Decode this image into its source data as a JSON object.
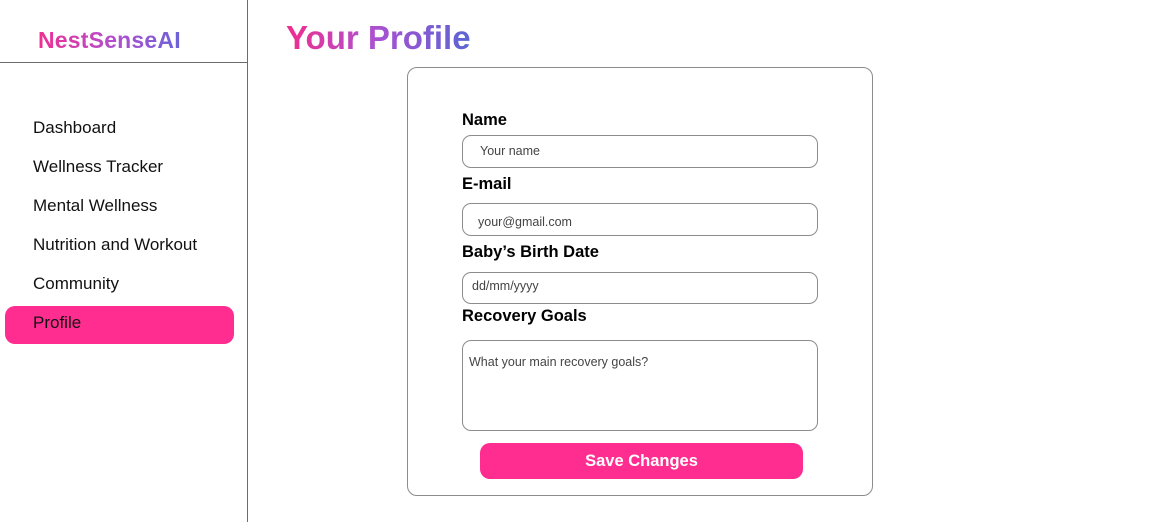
{
  "app": {
    "brand": "NestSenseAI"
  },
  "sidebar": {
    "items": [
      {
        "label": "Dashboard",
        "active": false
      },
      {
        "label": "Wellness Tracker",
        "active": false
      },
      {
        "label": "Mental Wellness",
        "active": false
      },
      {
        "label": "Nutrition and Workout",
        "active": false
      },
      {
        "label": "Community",
        "active": false
      },
      {
        "label": "Profile",
        "active": true
      }
    ]
  },
  "main": {
    "title": "Your Profile",
    "form": {
      "name_label": "Name",
      "name_placeholder": "Your name",
      "email_label": "E-mail",
      "email_placeholder": "your@gmail.com",
      "birth_label": "Baby’s Birth Date",
      "birth_placeholder": "dd/mm/yyyy",
      "goals_label": "Recovery Goals",
      "goals_placeholder": "What your main recovery goals?",
      "save_label": "Save Changes"
    }
  },
  "colors": {
    "accent": "#ff2d8f",
    "brand_gradient_start": "#ee2f92",
    "brand_gradient_end": "#5b65d4",
    "border": "#8c8c8c"
  }
}
